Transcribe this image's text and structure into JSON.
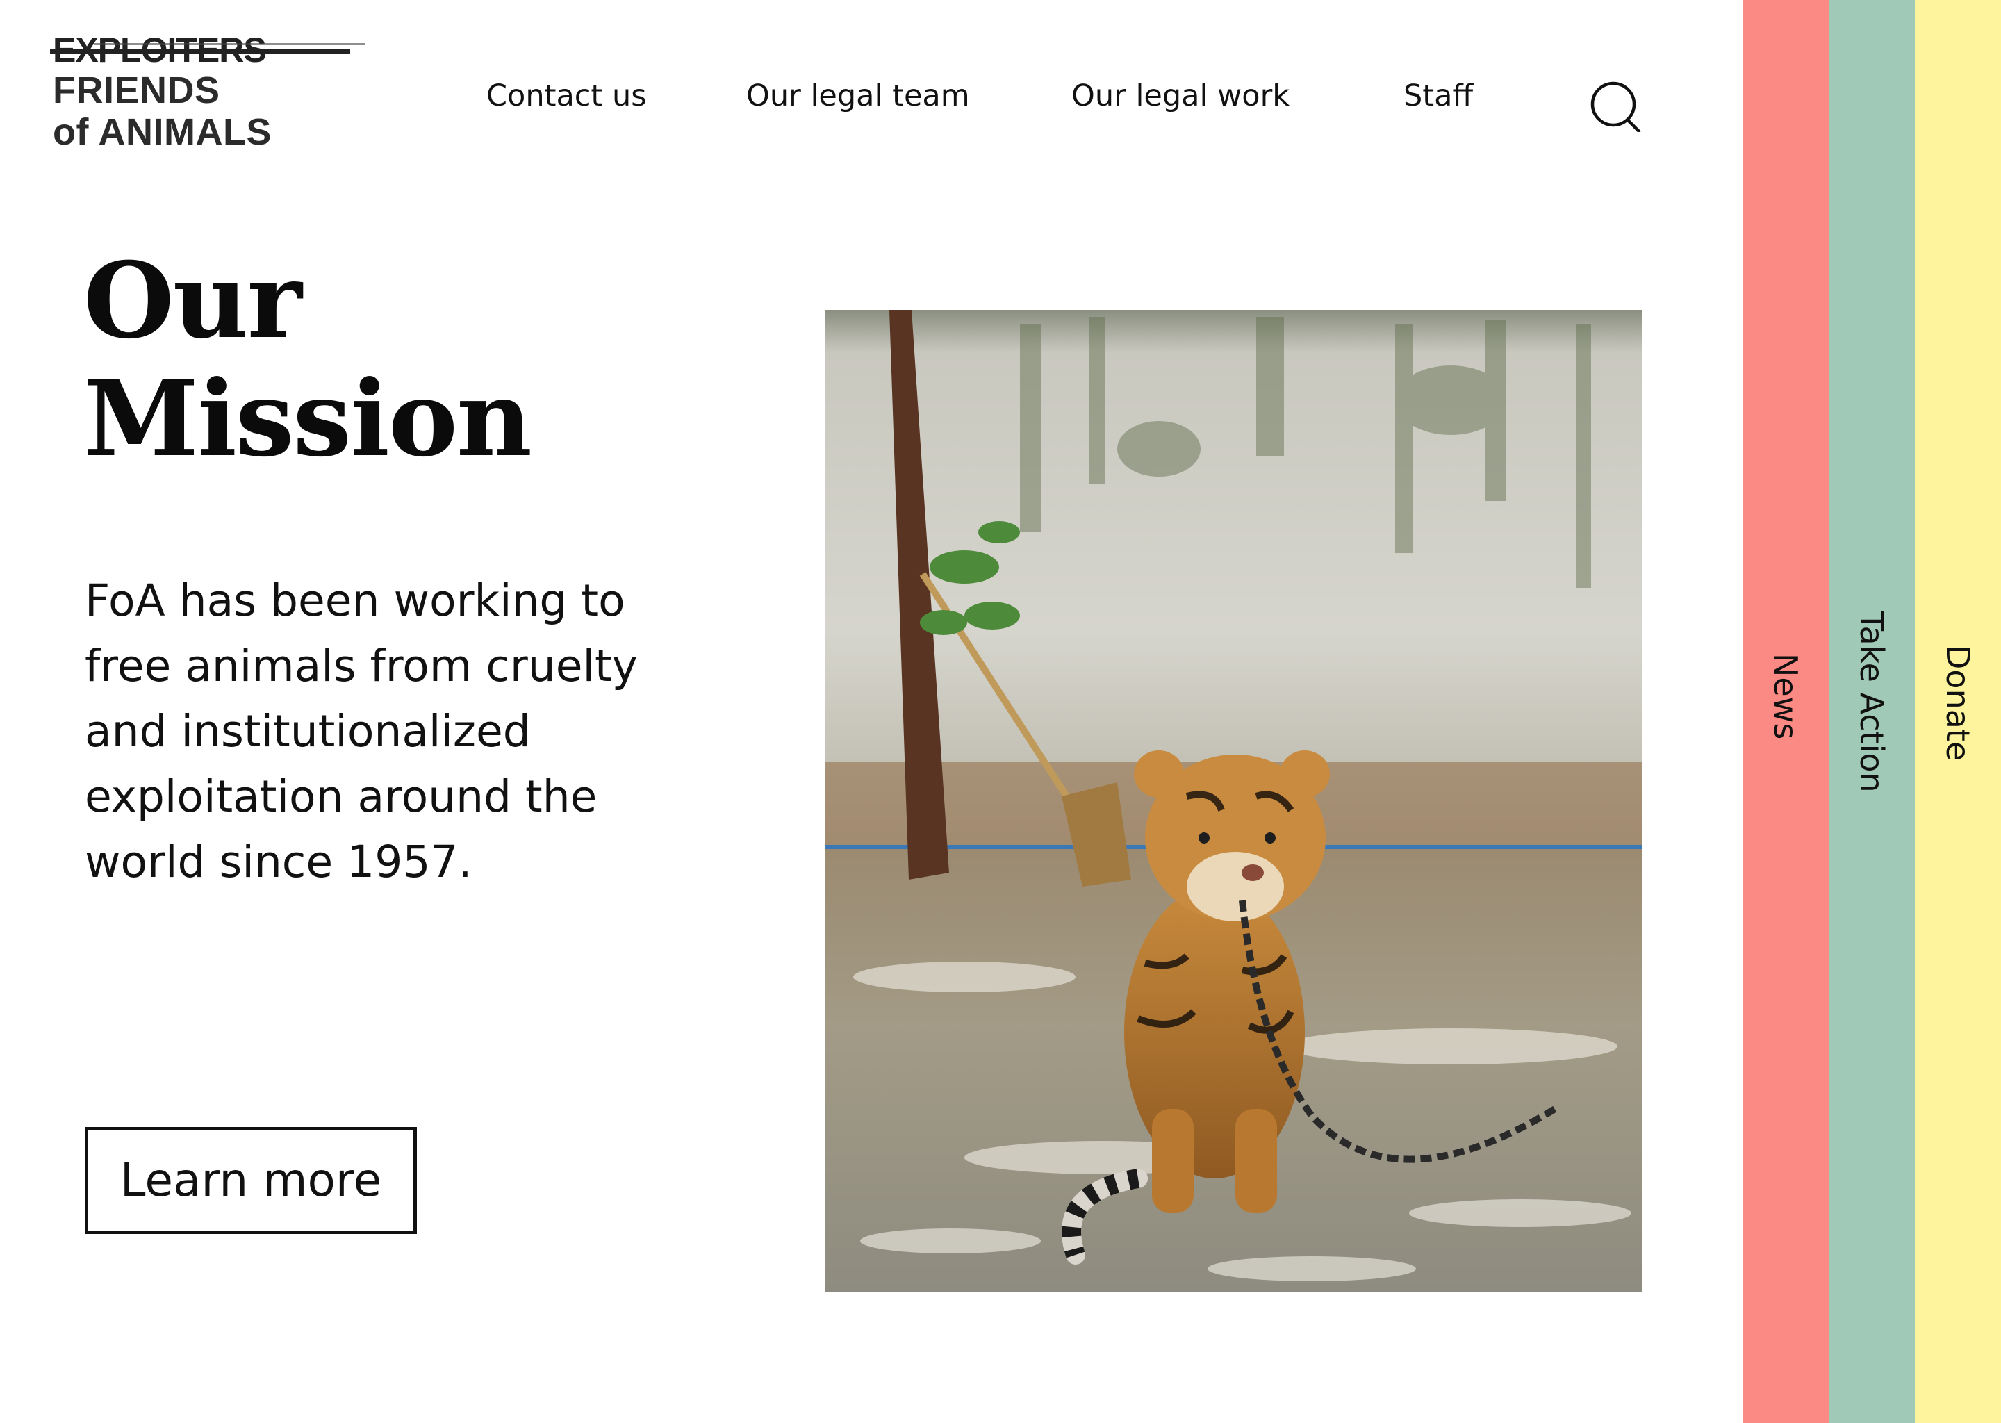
{
  "logo": {
    "strike_text": "EXPLOITERS",
    "line1": "FRIENDS",
    "line2": "of ANIMALS"
  },
  "nav": {
    "items": [
      {
        "label": "Contact us"
      },
      {
        "label": "Our legal team"
      },
      {
        "label": "Our legal work"
      },
      {
        "label": "Staff"
      }
    ],
    "search_icon": "search-icon"
  },
  "hero": {
    "title_line1": "Our",
    "title_line2": "Mission",
    "description": "FoA has been working to free animals from cruelty and institutionalized exploitation around the world since 1957.",
    "button_label": "Learn more"
  },
  "side_tabs": [
    {
      "label": "News",
      "color": "#fb8a84"
    },
    {
      "label": "Take Action",
      "color": "#a1c9b7"
    },
    {
      "label": "Donate",
      "color": "#fdf49d"
    }
  ]
}
